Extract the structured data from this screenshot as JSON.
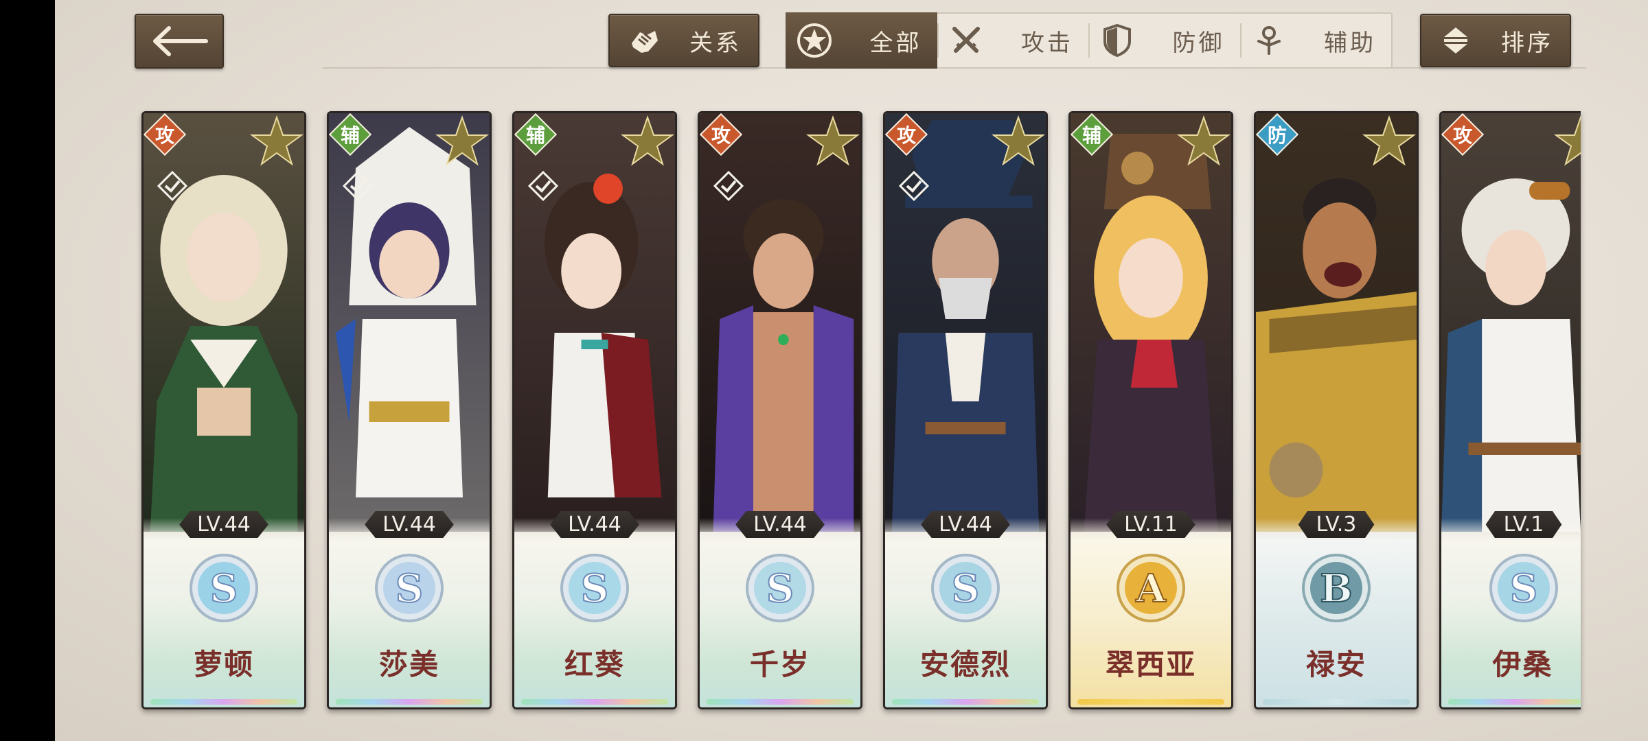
{
  "toolbar": {
    "relations_label": "关系",
    "sort_label": "排序",
    "filters": [
      {
        "label": "全部",
        "icon": "star-circle-icon",
        "active": true
      },
      {
        "label": "攻击",
        "icon": "crossed-swords-icon",
        "active": false
      },
      {
        "label": "防御",
        "icon": "shield-icon",
        "active": false
      },
      {
        "label": "辅助",
        "icon": "support-figure-icon",
        "active": false
      }
    ]
  },
  "characters": [
    {
      "name": "萝顿",
      "role": "攻",
      "level": "LV.44",
      "rank": "S"
    },
    {
      "name": "莎美",
      "role": "辅",
      "level": "LV.44",
      "rank": "S"
    },
    {
      "name": "红葵",
      "role": "辅",
      "level": "LV.44",
      "rank": "S"
    },
    {
      "name": "千岁",
      "role": "攻",
      "level": "LV.44",
      "rank": "S"
    },
    {
      "name": "安德烈",
      "role": "攻",
      "level": "LV.44",
      "rank": "S"
    },
    {
      "name": "翠西亚",
      "role": "辅",
      "level": "LV.11",
      "rank": "A"
    },
    {
      "name": "禄安",
      "role": "防",
      "level": "LV.3",
      "rank": "B"
    },
    {
      "name": "伊桑",
      "role": "攻",
      "level": "LV.1",
      "rank": "S"
    }
  ],
  "colors": {
    "button_brown": "#5f4e3c",
    "attack_role": "#c9582c",
    "support_role": "#5c9d3c",
    "defense_role": "#3c9dc4",
    "name_text": "#7a2f2a"
  }
}
